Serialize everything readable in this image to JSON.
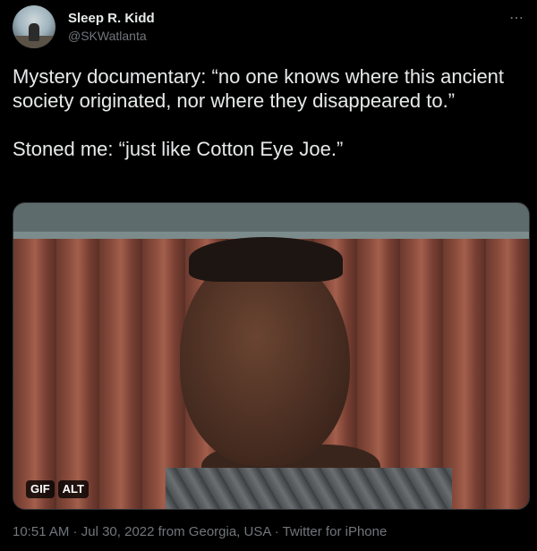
{
  "author": {
    "name": "Sleep R. Kidd",
    "handle": "@SKWatlanta"
  },
  "more_icon": "more-horizontal-icon",
  "tweet": {
    "line1": "Mystery documentary: “no one knows where this ancient society originated, nor where they disappeared to.”",
    "line2": "Stoned me:  “just like Cotton Eye Joe.”"
  },
  "media": {
    "gif_badge": "GIF",
    "alt_badge": "ALT"
  },
  "meta": {
    "time": "10:51 AM",
    "sep1": " · ",
    "date": "Jul 30, 2022",
    "location": " from Georgia, USA",
    "sep2": " · ",
    "source": "Twitter for iPhone"
  },
  "colors": {
    "background": "#000000",
    "text": "#e7e9ea",
    "secondary": "#71767b"
  }
}
